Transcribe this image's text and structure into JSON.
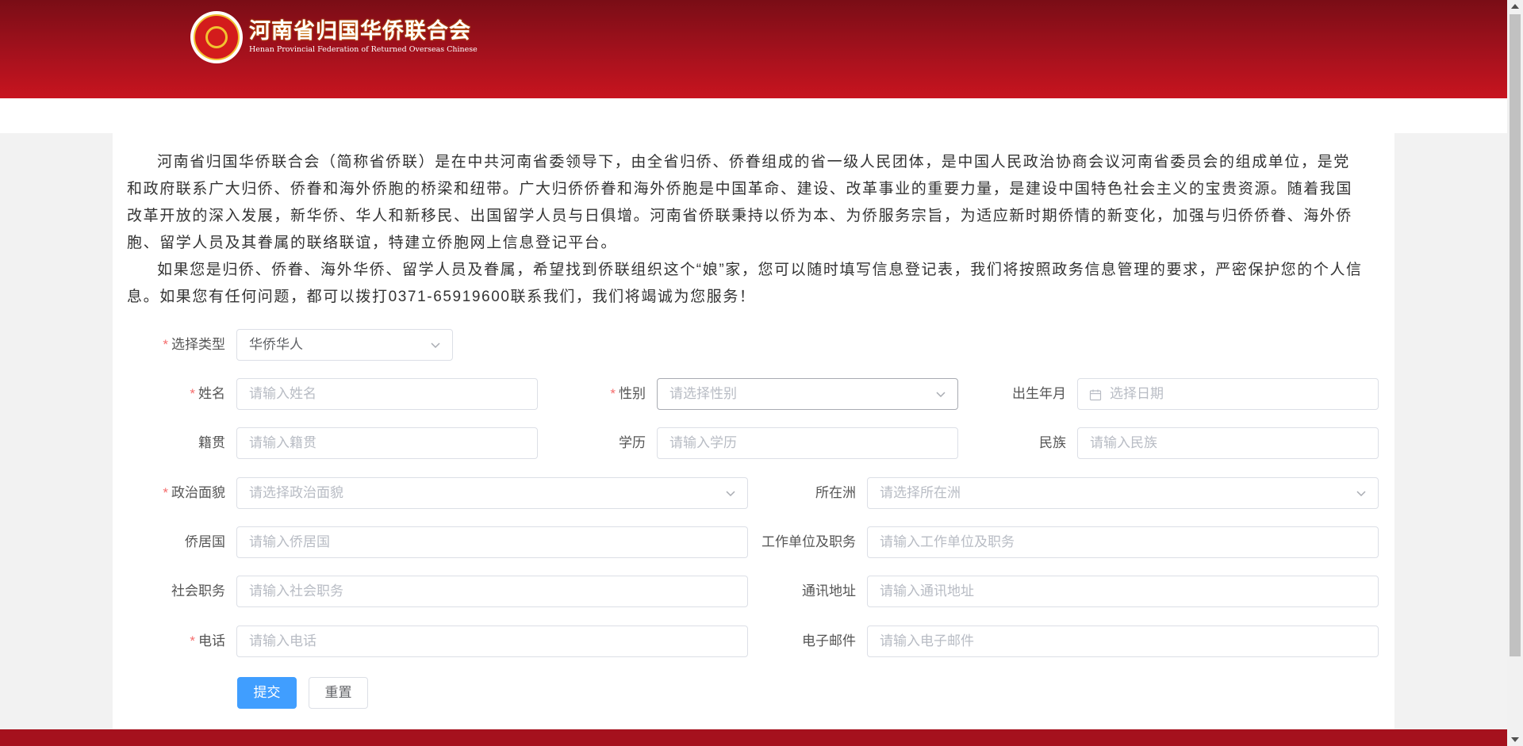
{
  "header": {
    "org_name_cn": "河南省归国华侨联合会",
    "org_name_en": "Henan Provincial Federation of Returned Overseas Chinese",
    "brand_color": "#a5111d"
  },
  "intro": {
    "paragraph1": "河南省归国华侨联合会（简称省侨联）是在中共河南省委领导下，由全省归侨、侨眷组成的省一级人民团体，是中国人民政治协商会议河南省委员会的组成单位，是党和政府联系广大归侨、侨眷和海外侨胞的桥梁和纽带。广大归侨侨眷和海外侨胞是中国革命、建设、改革事业的重要力量，是建设中国特色社会主义的宝贵资源。随着我国改革开放的深入发展，新华侨、华人和新移民、出国留学人员与日俱增。河南省侨联秉持以侨为本、为侨服务宗旨，为适应新时期侨情的新变化，加强与归侨侨眷、海外侨胞、留学人员及其眷属的联络联谊，特建立侨胞网上信息登记平台。",
    "paragraph2": "如果您是归侨、侨眷、海外华侨、留学人员及眷属，希望找到侨联组织这个“娘”家，您可以随时填写信息登记表，我们将按照政务信息管理的要求，严密保护您的个人信息。如果您有任何问题，都可以拨打0371-65919600联系我们，我们将竭诚为您服务！"
  },
  "form": {
    "required_mark": "*",
    "type": {
      "label": "选择类型",
      "value": "华侨华人"
    },
    "name": {
      "label": "姓名",
      "placeholder": "请输入姓名"
    },
    "gender": {
      "label": "性别",
      "placeholder": "请选择性别"
    },
    "birth": {
      "label": "出生年月",
      "placeholder": "选择日期"
    },
    "native_place": {
      "label": "籍贯",
      "placeholder": "请输入籍贯"
    },
    "education": {
      "label": "学历",
      "placeholder": "请输入学历"
    },
    "ethnicity": {
      "label": "民族",
      "placeholder": "请输入民族"
    },
    "political": {
      "label": "政治面貌",
      "placeholder": "请选择政治面貌"
    },
    "continent": {
      "label": "所在洲",
      "placeholder": "请选择所在洲"
    },
    "residence_country": {
      "label": "侨居国",
      "placeholder": "请输入侨居国"
    },
    "work_unit": {
      "label": "工作单位及职务",
      "placeholder": "请输入工作单位及职务"
    },
    "social_position": {
      "label": "社会职务",
      "placeholder": "请输入社会职务"
    },
    "address": {
      "label": "通讯地址",
      "placeholder": "请输入通讯地址"
    },
    "phone": {
      "label": "电话",
      "placeholder": "请输入电话"
    },
    "email": {
      "label": "电子邮件",
      "placeholder": "请输入电子邮件"
    },
    "submit_label": "提交",
    "reset_label": "重置",
    "accent_color": "#409eff",
    "required_color": "#f56c6c"
  },
  "icons": {
    "dropdown": "chevron-down-icon",
    "date": "calendar-icon",
    "logo": "federation-emblem-icon"
  }
}
